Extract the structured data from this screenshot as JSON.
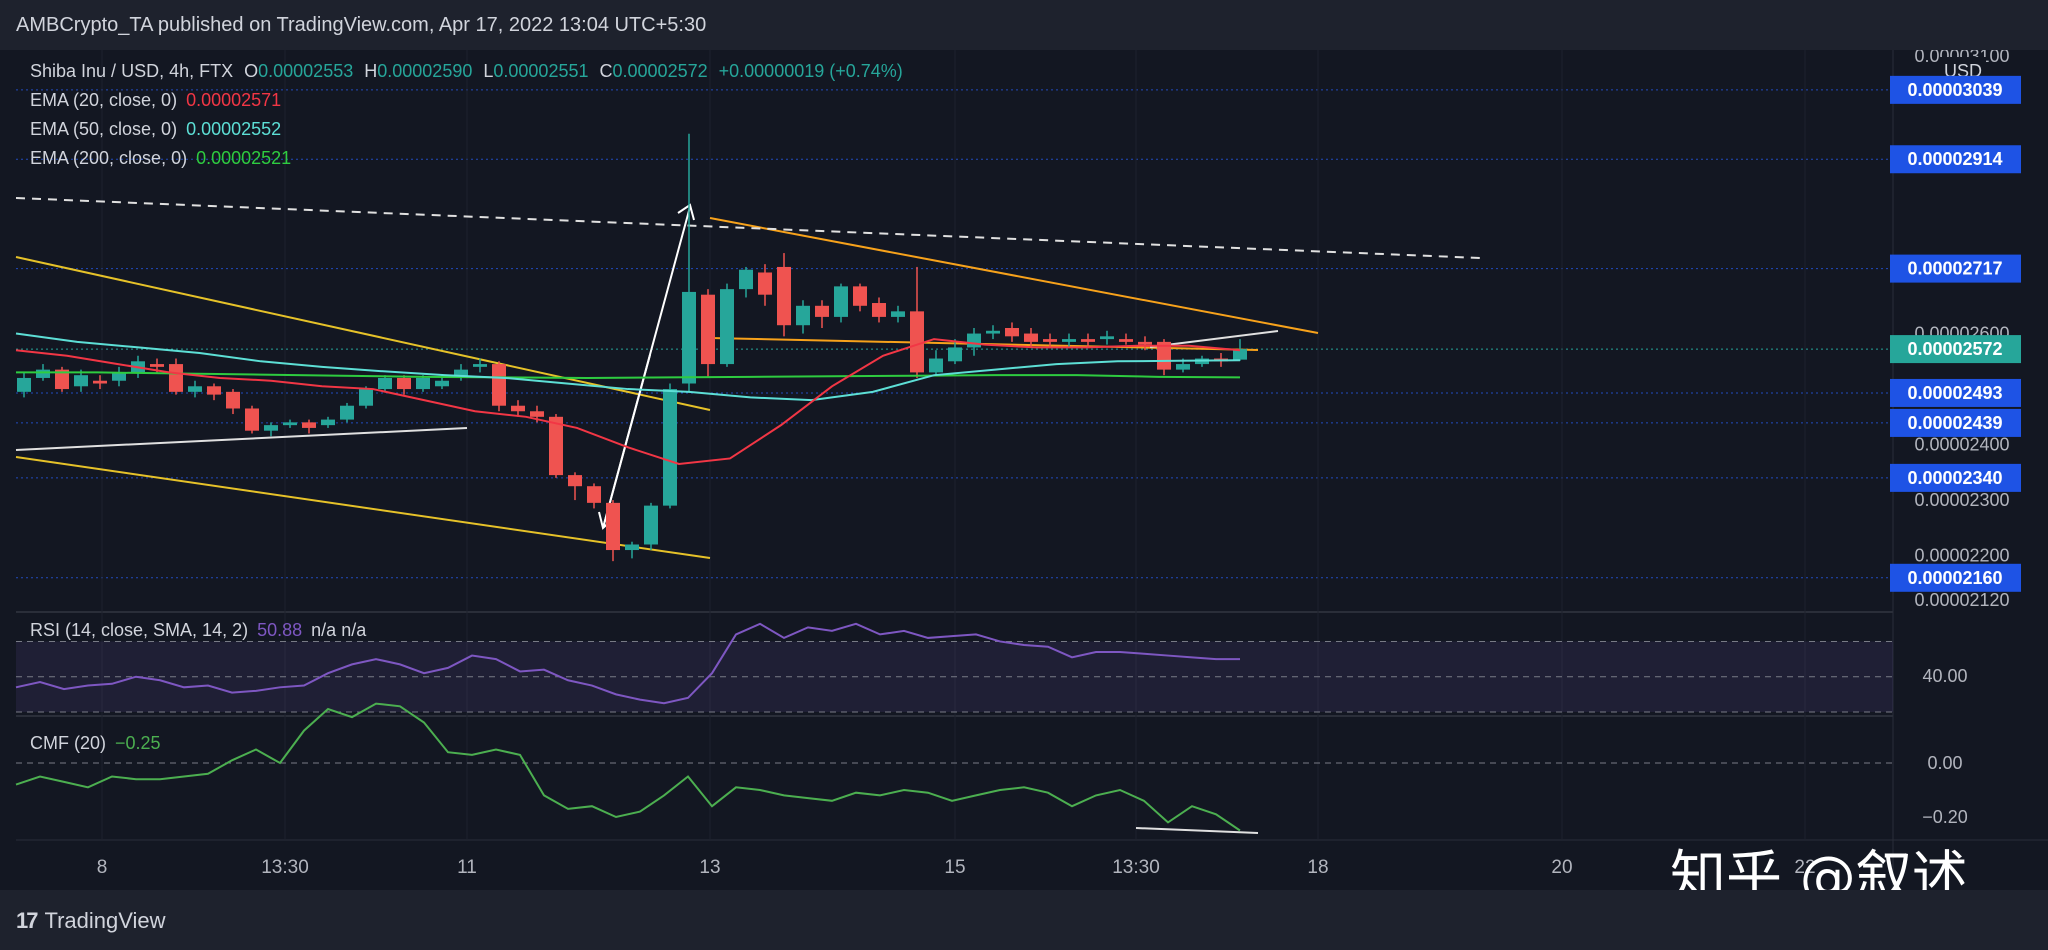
{
  "header": {
    "text": "AMBCrypto_TA published on TradingView.com, Apr 17, 2022 13:04 UTC+5:30"
  },
  "footer": {
    "brand": "TradingView"
  },
  "watermark": "知乎 @叙述",
  "legend": {
    "symbol": "Shiba Inu / USD, 4h, FTX",
    "o_label": "O",
    "o": "0.00002553",
    "h_label": "H",
    "h": "0.00002590",
    "l_label": "L",
    "l": "0.00002551",
    "c_label": "C",
    "c": "0.00002572",
    "change": "+0.00000019 (+0.74%)",
    "ema20_label": "EMA (20, close, 0)",
    "ema20": "0.00002571",
    "ema50_label": "EMA (50, close, 0)",
    "ema50": "0.00002552",
    "ema200_label": "EMA (200, close, 0)",
    "ema200": "0.00002521",
    "rsi_label": "RSI (14, close, SMA, 14, 2)",
    "rsi": "50.88",
    "rsi_extra": "n/a  n/a",
    "cmf_label": "CMF (20)",
    "cmf": "−0.25"
  },
  "colors": {
    "bg": "#131722",
    "up": "#26a69a",
    "down": "#ef5350",
    "ema20": "#f23645",
    "ema50": "#5ddfd6",
    "ema200": "#2ecc40",
    "rsi": "#7e57c2",
    "cmf": "#4caf50",
    "badge": "#1e53e5",
    "last_badge": "#26a69a",
    "trend_yellow": "#e6c229",
    "trend_orange": "#f7a21b"
  },
  "chart_data": {
    "type": "candlestick",
    "title": "Shiba Inu / USD, 4h, FTX",
    "currency_label": "USD",
    "price_ticks": [
      "0.00003100",
      "0.00002600",
      "0.00002400",
      "0.00002300",
      "0.00002200",
      "0.00002120"
    ],
    "price_badges": [
      "0.00003039",
      "0.00002914",
      "0.00002717",
      "0.00002493",
      "0.00002439",
      "0.00002340",
      "0.00002160"
    ],
    "last_price": "0.00002572",
    "x_ticks": [
      "8",
      "13:30",
      "11",
      "13",
      "15",
      "13:30",
      "18",
      "20",
      "22"
    ],
    "ylim": [
      2.12e-05,
      3.1e-05
    ],
    "candles": [
      [
        2.495,
        2.52,
        2.485,
        2.53
      ],
      [
        2.52,
        2.535,
        2.515,
        2.545
      ],
      [
        2.535,
        2.5,
        2.495,
        2.54
      ],
      [
        2.505,
        2.525,
        2.495,
        2.535
      ],
      [
        2.515,
        2.51,
        2.5,
        2.525
      ],
      [
        2.515,
        2.53,
        2.505,
        2.54
      ],
      [
        2.53,
        2.55,
        2.52,
        2.56
      ],
      [
        2.545,
        2.54,
        2.53,
        2.555
      ],
      [
        2.545,
        2.495,
        2.49,
        2.555
      ],
      [
        2.495,
        2.505,
        2.485,
        2.515
      ],
      [
        2.505,
        2.49,
        2.48,
        2.51
      ],
      [
        2.495,
        2.465,
        2.455,
        2.5
      ],
      [
        2.465,
        2.425,
        2.42,
        2.47
      ],
      [
        2.425,
        2.435,
        2.415,
        2.44
      ],
      [
        2.435,
        2.44,
        2.43,
        2.445
      ],
      [
        2.44,
        2.43,
        2.42,
        2.445
      ],
      [
        2.435,
        2.445,
        2.43,
        2.45
      ],
      [
        2.445,
        2.47,
        2.44,
        2.475
      ],
      [
        2.47,
        2.5,
        2.465,
        2.505
      ],
      [
        2.5,
        2.52,
        2.495,
        2.525
      ],
      [
        2.52,
        2.5,
        2.49,
        2.525
      ],
      [
        2.5,
        2.52,
        2.495,
        2.525
      ],
      [
        2.505,
        2.515,
        2.5,
        2.525
      ],
      [
        2.52,
        2.535,
        2.515,
        2.545
      ],
      [
        2.54,
        2.545,
        2.53,
        2.555
      ],
      [
        2.545,
        2.47,
        2.46,
        2.55
      ],
      [
        2.47,
        2.46,
        2.45,
        2.48
      ],
      [
        2.46,
        2.45,
        2.44,
        2.47
      ],
      [
        2.45,
        2.345,
        2.34,
        2.455
      ],
      [
        2.345,
        2.325,
        2.3,
        2.35
      ],
      [
        2.325,
        2.295,
        2.285,
        2.33
      ],
      [
        2.295,
        2.21,
        2.19,
        2.3
      ],
      [
        2.21,
        2.22,
        2.195,
        2.225
      ],
      [
        2.22,
        2.29,
        2.21,
        2.295
      ],
      [
        2.29,
        2.5,
        2.285,
        2.51
      ],
      [
        2.51,
        2.675,
        2.495,
        2.96
      ],
      [
        2.67,
        2.545,
        2.52,
        2.68
      ],
      [
        2.545,
        2.68,
        2.54,
        2.69
      ],
      [
        2.68,
        2.715,
        2.665,
        2.72
      ],
      [
        2.71,
        2.67,
        2.65,
        2.725
      ],
      [
        2.72,
        2.615,
        2.595,
        2.745
      ],
      [
        2.615,
        2.65,
        2.6,
        2.66
      ],
      [
        2.65,
        2.63,
        2.61,
        2.66
      ],
      [
        2.63,
        2.685,
        2.62,
        2.69
      ],
      [
        2.685,
        2.65,
        2.64,
        2.69
      ],
      [
        2.655,
        2.63,
        2.62,
        2.665
      ],
      [
        2.63,
        2.64,
        2.62,
        2.65
      ],
      [
        2.64,
        2.53,
        2.52,
        2.72
      ],
      [
        2.53,
        2.555,
        2.525,
        2.57
      ],
      [
        2.55,
        2.575,
        2.545,
        2.59
      ],
      [
        2.575,
        2.6,
        2.56,
        2.61
      ],
      [
        2.6,
        2.605,
        2.59,
        2.615
      ],
      [
        2.61,
        2.595,
        2.585,
        2.62
      ],
      [
        2.6,
        2.585,
        2.575,
        2.61
      ],
      [
        2.59,
        2.585,
        2.575,
        2.6
      ],
      [
        2.585,
        2.59,
        2.575,
        2.6
      ],
      [
        2.59,
        2.585,
        2.575,
        2.6
      ],
      [
        2.59,
        2.595,
        2.58,
        2.605
      ],
      [
        2.59,
        2.585,
        2.58,
        2.6
      ],
      [
        2.585,
        2.58,
        2.57,
        2.595
      ],
      [
        2.585,
        2.535,
        2.525,
        2.59
      ],
      [
        2.535,
        2.545,
        2.53,
        2.555
      ],
      [
        2.545,
        2.555,
        2.54,
        2.56
      ],
      [
        2.555,
        2.55,
        2.54,
        2.565
      ],
      [
        2.553,
        2.572,
        2.551,
        2.59
      ]
    ],
    "ema20": [
      2.57,
      2.56,
      2.545,
      2.53,
      2.52,
      2.515,
      2.505,
      2.5,
      2.48,
      2.46,
      2.45,
      2.43,
      2.395,
      2.365,
      2.375,
      2.435,
      2.505,
      2.56,
      2.59,
      2.58,
      2.575,
      2.575,
      2.578,
      2.578,
      2.57
    ],
    "ema50": [
      2.6,
      2.585,
      2.575,
      2.565,
      2.55,
      2.54,
      2.532,
      2.525,
      2.52,
      2.51,
      2.5,
      2.495,
      2.485,
      2.48,
      2.495,
      2.525,
      2.535,
      2.545,
      2.55,
      2.551,
      2.552
    ],
    "ema200": [
      2.53,
      2.53,
      2.528,
      2.526,
      2.524,
      2.522,
      2.521,
      2.52,
      2.521,
      2.522,
      2.523,
      2.524,
      2.525,
      2.525,
      2.522,
      2.521
    ],
    "rsi": {
      "value": 50.88,
      "level_label": "40.00",
      "series": [
        44,
        47,
        43,
        45,
        46,
        50,
        48,
        44,
        45,
        41,
        42,
        44,
        45,
        52,
        57,
        60,
        57,
        52,
        55,
        62,
        60,
        53,
        54,
        48,
        45,
        40,
        37,
        35,
        38,
        52,
        74,
        80,
        72,
        78,
        76,
        80,
        74,
        76,
        72,
        73,
        74,
        70,
        68,
        67,
        61,
        64,
        64,
        63,
        62,
        61,
        60,
        60
      ]
    },
    "cmf": {
      "value": -0.25,
      "ticks": [
        "0.00",
        "−0.20"
      ],
      "series": [
        -0.08,
        -0.05,
        -0.07,
        -0.09,
        -0.05,
        -0.06,
        -0.06,
        -0.05,
        -0.04,
        0.01,
        0.05,
        0.0,
        0.12,
        0.2,
        0.17,
        0.22,
        0.21,
        0.15,
        0.04,
        0.03,
        0.05,
        0.03,
        -0.12,
        -0.17,
        -0.16,
        -0.2,
        -0.18,
        -0.12,
        -0.05,
        -0.16,
        -0.09,
        -0.1,
        -0.12,
        -0.13,
        -0.14,
        -0.11,
        -0.12,
        -0.1,
        -0.11,
        -0.14,
        -0.12,
        -0.1,
        -0.09,
        -0.11,
        -0.16,
        -0.12,
        -0.1,
        -0.14,
        -0.22,
        -0.16,
        -0.19,
        -0.25
      ]
    }
  }
}
